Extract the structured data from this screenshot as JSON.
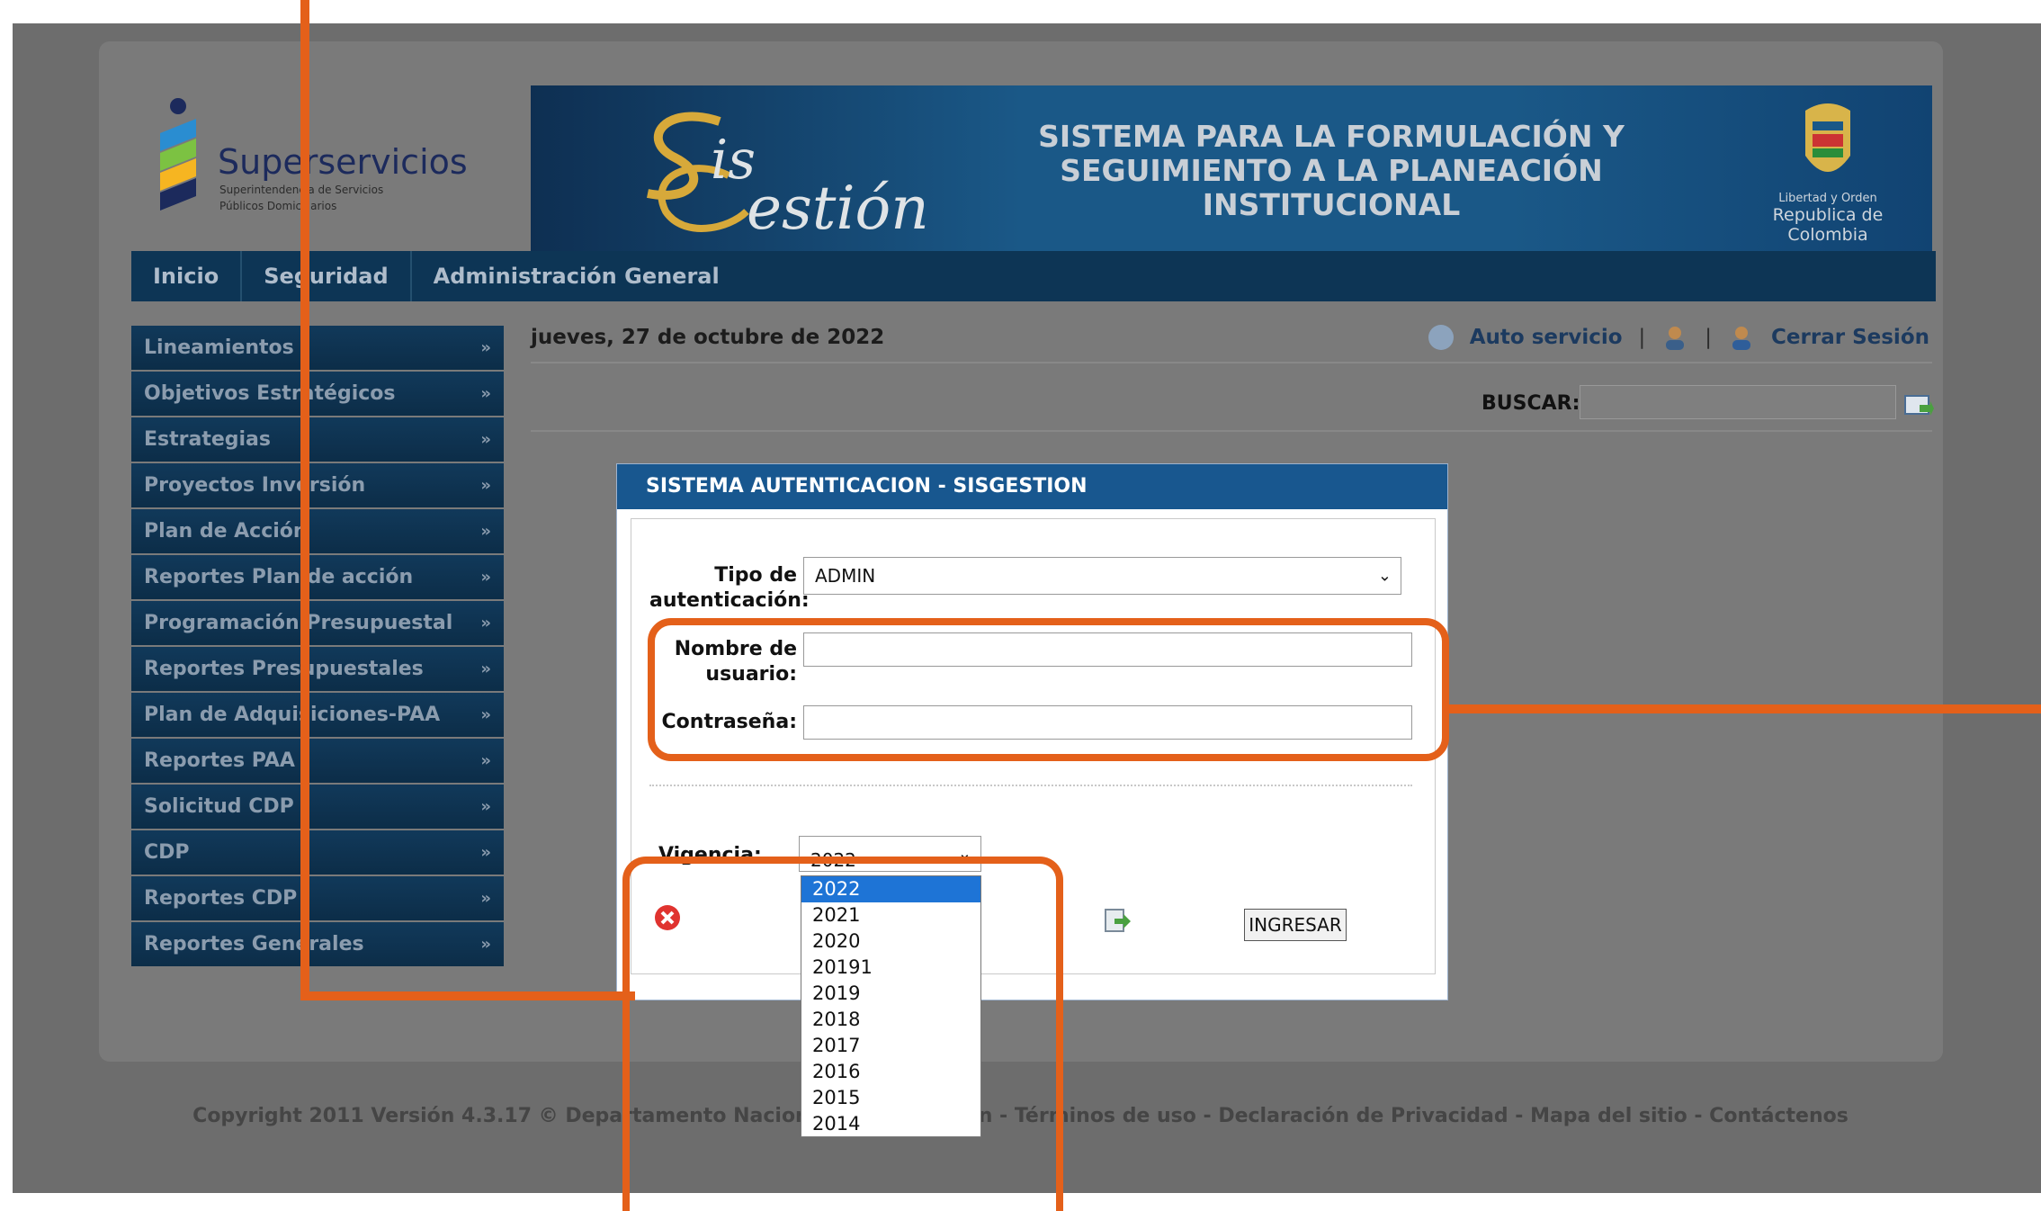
{
  "logo": {
    "brand": "Superservicios",
    "sub_line1": "Superintendencia de Servicios",
    "sub_line2": "Públicos Domiciliarios"
  },
  "banner": {
    "sis_word1": "is",
    "sis_word2": "estión",
    "title": "SISTEMA PARA LA FORMULACIÓN Y SEGUIMIENTO A LA PLANEACIÓN INSTITUCIONAL",
    "crest_motto": "Libertad y Orden",
    "crest_country": "Republica de Colombia"
  },
  "nav": {
    "items": [
      {
        "label": "Inicio"
      },
      {
        "label": "Seguridad"
      },
      {
        "label": "Administración General"
      }
    ]
  },
  "sidebar": {
    "items": [
      {
        "label": "Lineamientos"
      },
      {
        "label": "Objetivos Estratégicos"
      },
      {
        "label": "Estrategias"
      },
      {
        "label": "Proyectos Inversión"
      },
      {
        "label": "Plan de Acción"
      },
      {
        "label": "Reportes Plan de acción"
      },
      {
        "label": "Programación Presupuestal"
      },
      {
        "label": "Reportes Presupuestales"
      },
      {
        "label": "Plan de Adquisiciones-PAA"
      },
      {
        "label": "Reportes PAA"
      },
      {
        "label": "Solicitud CDP"
      },
      {
        "label": "CDP"
      },
      {
        "label": "Reportes CDP"
      },
      {
        "label": "Reportes Generales"
      }
    ],
    "chevron": "»"
  },
  "header": {
    "date": "jueves, 27 de octubre de 2022",
    "auto_servicio": "Auto servicio",
    "separator": "|",
    "cerrar_sesion": "Cerrar Sesión",
    "buscar_label": "BUSCAR:"
  },
  "modal": {
    "title": "SISTEMA AUTENTICACION - SISGESTION",
    "tipo_label_1": "Tipo de",
    "tipo_label_2": "autenticación:",
    "tipo_value": "ADMIN",
    "usuario_label_1": "Nombre de",
    "usuario_label_2": "usuario:",
    "password_label": "Contraseña:",
    "vigencia_label": "Vigencia: :",
    "vigencia_value": "2022",
    "ingresar_label": "INGRESAR"
  },
  "vigencia_options": [
    "2022",
    "2021",
    "2020",
    "20191",
    "2019",
    "2018",
    "2017",
    "2016",
    "2015",
    "2014"
  ],
  "footer": {
    "text": "Copyright 2011 Versión 4.3.17 © Departamento Nacional de Planeación - Términos de uso - Declaración de Privacidad - Mapa del sitio - Contáctenos"
  },
  "colors": {
    "annotation": "#e4601a",
    "header_blue": "#18578f",
    "nav_dark": "#0d3555"
  }
}
